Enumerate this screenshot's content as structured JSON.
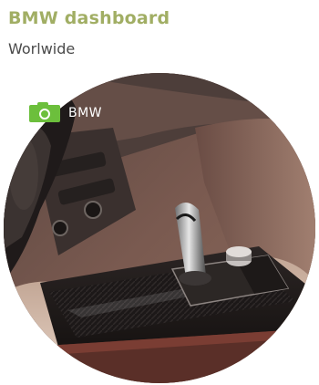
{
  "header": {
    "title": "BMW dashboard",
    "subtitle": "Worlwide"
  },
  "photo": {
    "caption": "BMW",
    "caption_icon": "camera-icon",
    "caption_icon_color": "#6cbf3c",
    "title_color": "#a1ae64"
  }
}
